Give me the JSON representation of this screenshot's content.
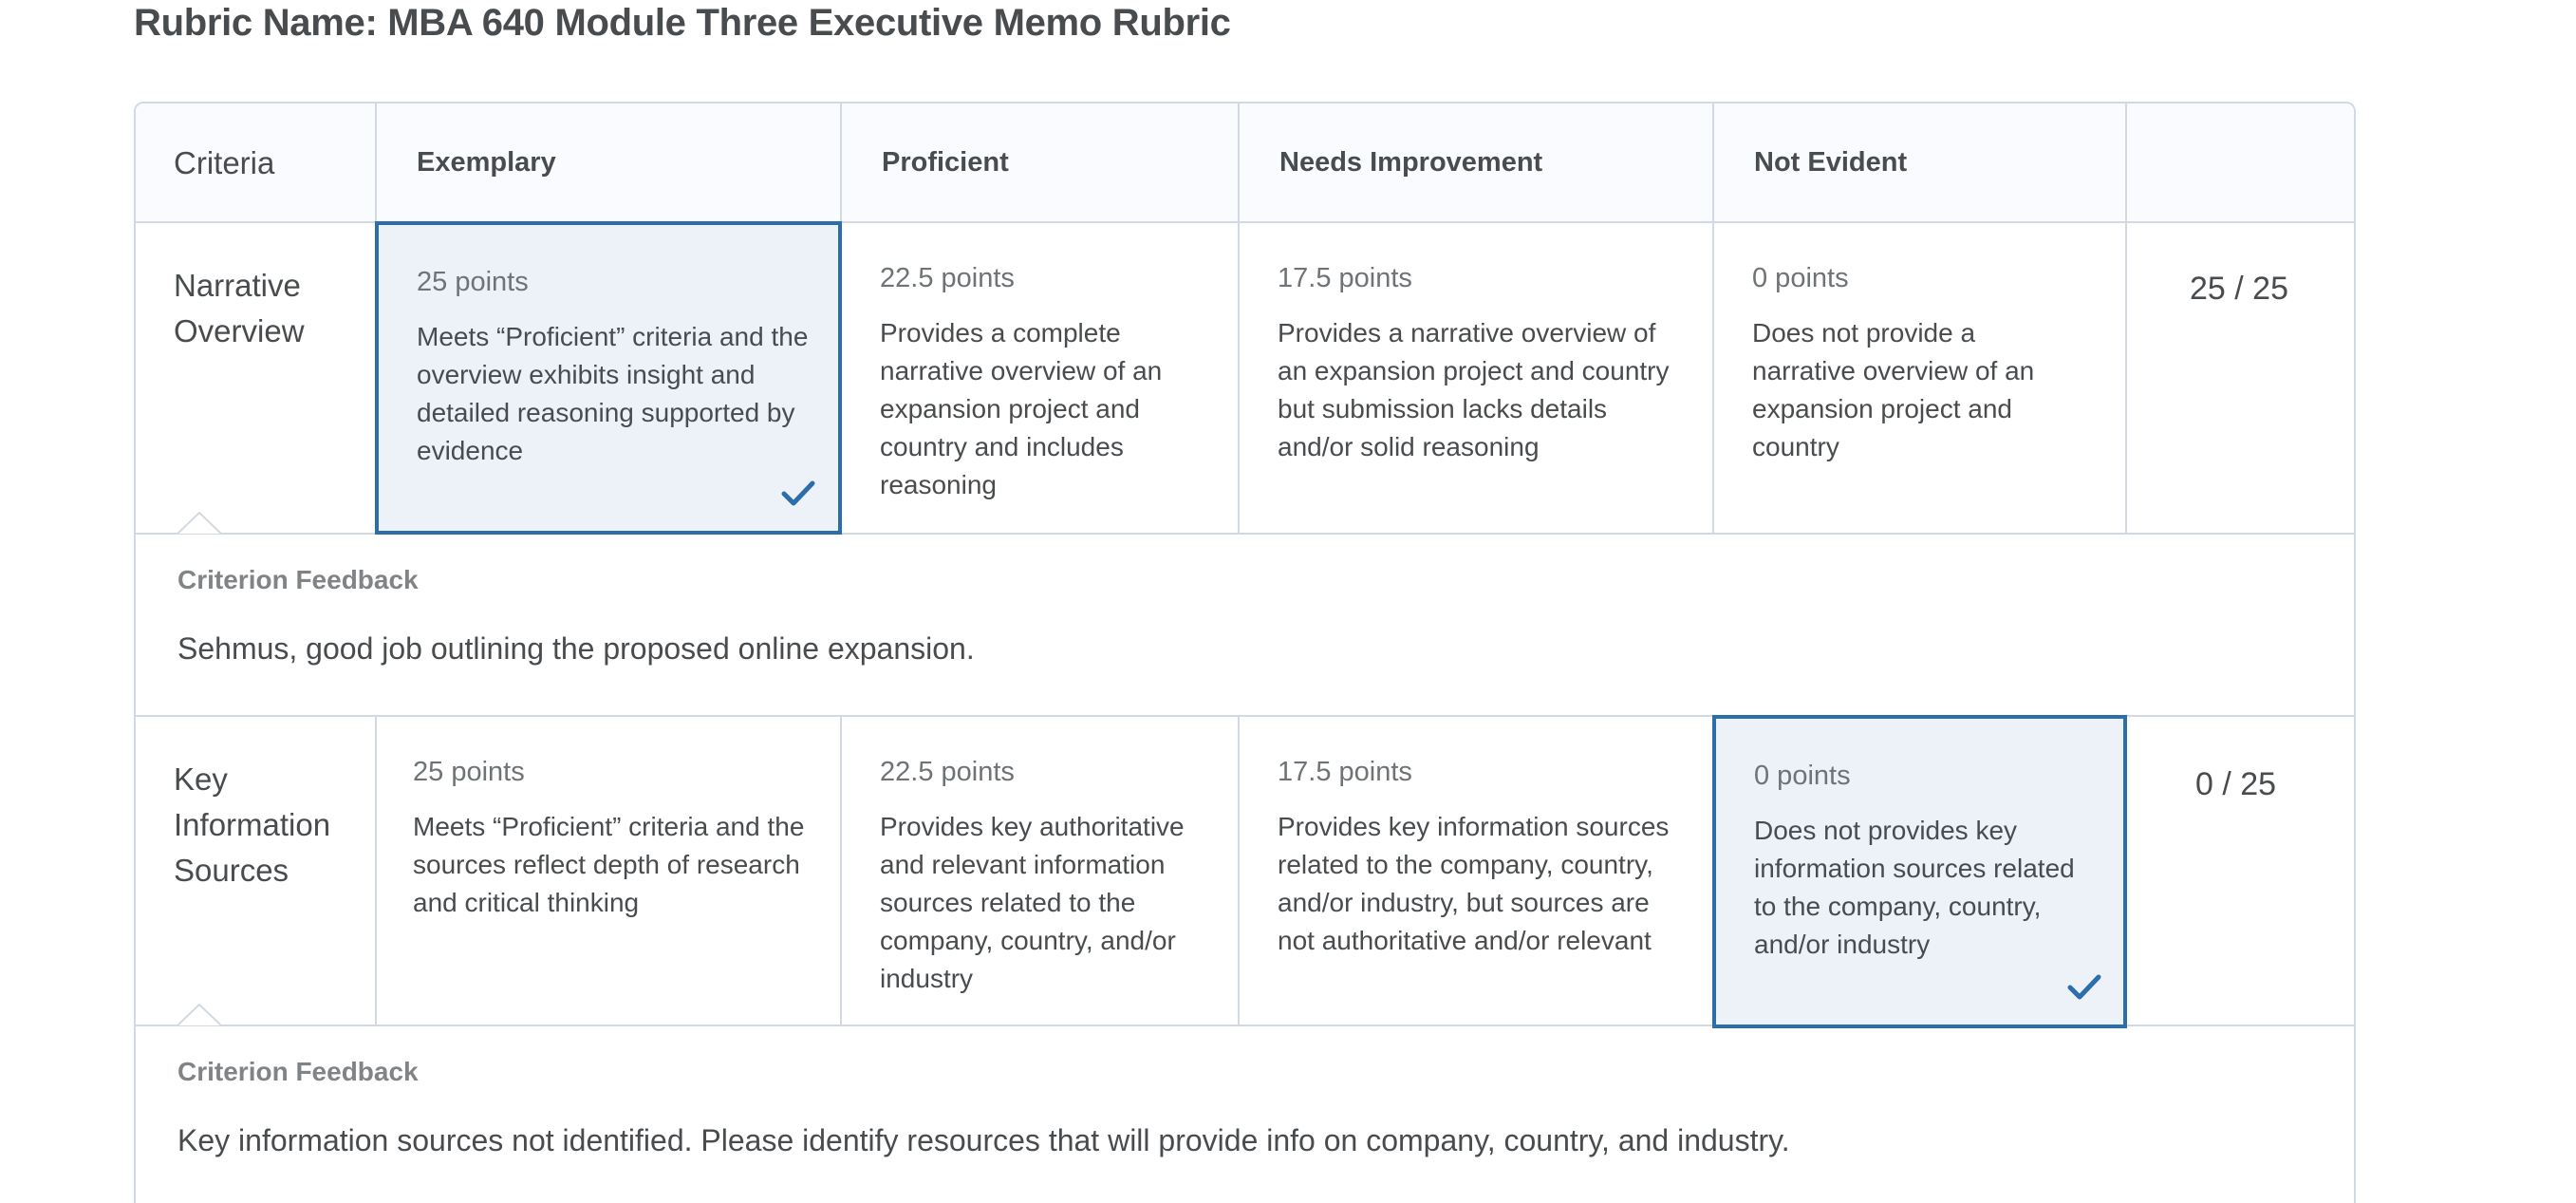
{
  "title": "Rubric Name: MBA 640 Module Three Executive Memo Rubric",
  "headers": {
    "criteria": "Criteria",
    "levels": [
      "Exemplary",
      "Proficient",
      "Needs Improvement",
      "Not Evident"
    ],
    "score": ""
  },
  "criteria": [
    {
      "name": "Narrative Overview",
      "selected_level": "Exemplary",
      "cells": [
        {
          "points": "25 points",
          "description": "Meets “Proficient” criteria and the overview exhibits insight and detailed reasoning supported by evidence"
        },
        {
          "points": "22.5 points",
          "description": "Provides a complete narrative overview of an expansion project and country and includes reasoning"
        },
        {
          "points": "17.5 points",
          "description": "Provides a narrative overview of an expansion project and country but submission lacks details and/or solid reasoning"
        },
        {
          "points": "0 points",
          "description": "Does not provide a narrative overview of an expansion project and country"
        }
      ],
      "score": "25 / 25",
      "feedback_label": "Criterion Feedback",
      "feedback": "Sehmus, good job outlining the proposed online expansion."
    },
    {
      "name": "Key Information Sources",
      "selected_level": "Not Evident",
      "cells": [
        {
          "points": "25 points",
          "description": "Meets “Proficient” criteria and the sources reflect depth of research and critical thinking"
        },
        {
          "points": "22.5 points",
          "description": "Provides key authoritative and relevant information sources related to the company, country, and/or industry"
        },
        {
          "points": "17.5 points",
          "description": "Provides key information sources related to the company, country, and/or industry, but sources are not authoritative and/or relevant"
        },
        {
          "points": "0 points",
          "description": "Does not provides key information sources related to the company, country, and/or industry"
        }
      ],
      "score": "0 / 25",
      "feedback_label": "Criterion Feedback",
      "feedback": "Key information sources not identified. Please identify resources that will provide info on company, country, and industry."
    }
  ],
  "icons": {
    "selected": "checkmark-icon",
    "feedback_pointer": "caret-up-icon"
  },
  "colors": {
    "selected_border": "#2c6dac",
    "selected_fill": "#edf2f9",
    "grid_line": "#d3d9e3",
    "text": "#494c4e",
    "muted_text": "#6e7376"
  }
}
